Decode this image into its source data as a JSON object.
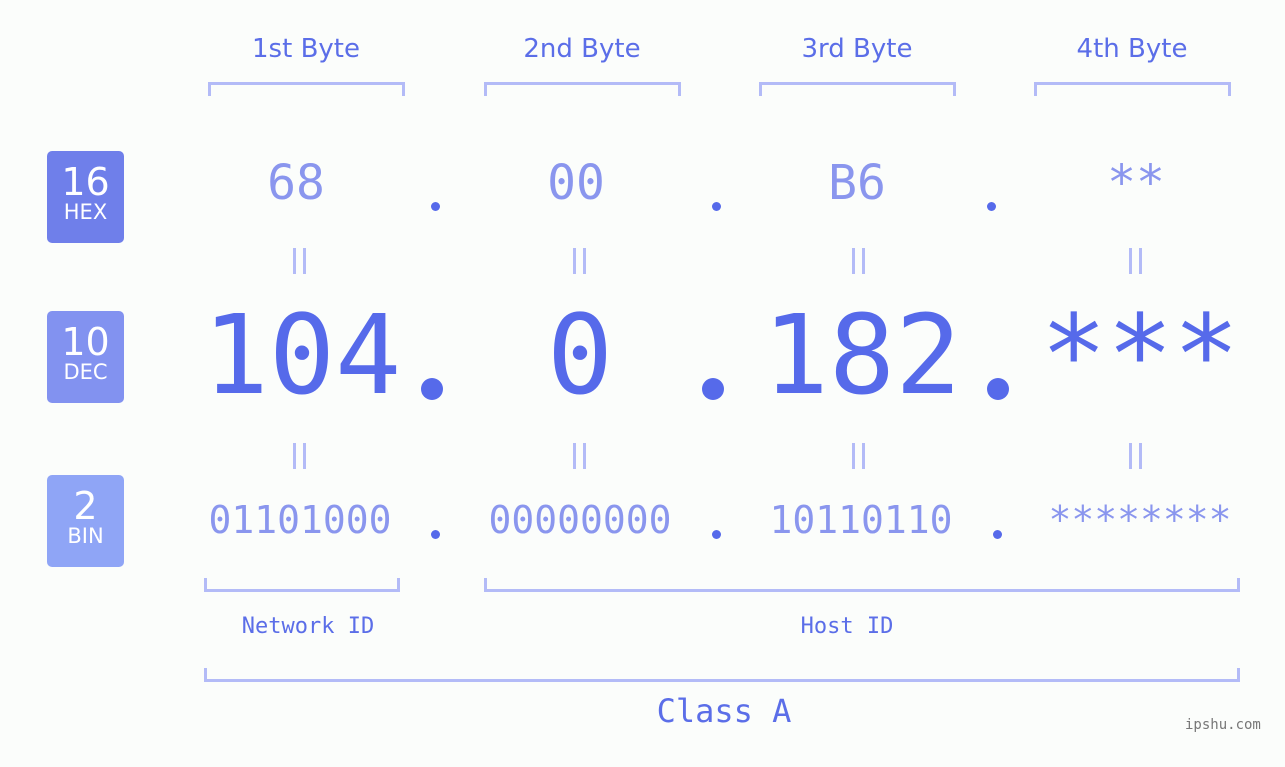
{
  "byte_headers": [
    "1st Byte",
    "2nd Byte",
    "3rd Byte",
    "4th Byte"
  ],
  "badges": {
    "hex": {
      "number": "16",
      "label": "HEX",
      "color": "#6f7fea"
    },
    "dec": {
      "number": "10",
      "label": "DEC",
      "color": "#8292f0"
    },
    "bin": {
      "number": "2",
      "label": "BIN",
      "color": "#8fa5f6"
    }
  },
  "hex_values": [
    "68",
    "00",
    "B6",
    "**"
  ],
  "dec_values": [
    "104",
    "0",
    "182",
    "***"
  ],
  "bin_values": [
    "01101000",
    "00000000",
    "10110110",
    "********"
  ],
  "network_id_label": "Network ID",
  "host_id_label": "Host ID",
  "class_label": "Class A",
  "watermark": "ipshu.com",
  "colors": {
    "primary": "#566aea",
    "light": "#8a96ee",
    "bracket": "#b3bbf7"
  }
}
